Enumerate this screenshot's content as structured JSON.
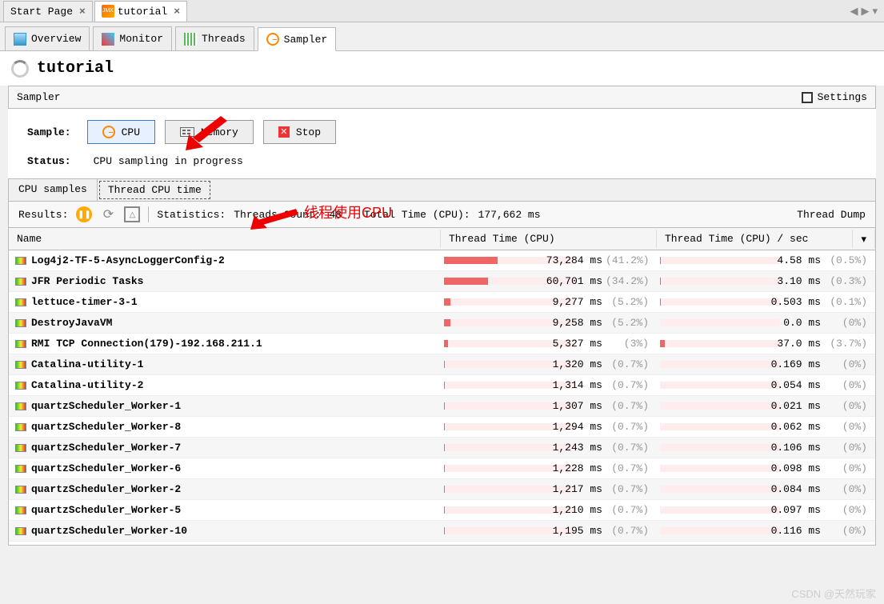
{
  "top_tabs": {
    "start_page": "Start Page",
    "tutorial": "tutorial"
  },
  "sub_tabs": {
    "overview": "Overview",
    "monitor": "Monitor",
    "threads": "Threads",
    "sampler": "Sampler"
  },
  "title": "tutorial",
  "section": {
    "label": "Sampler",
    "settings": "Settings"
  },
  "sample": {
    "label": "Sample:",
    "cpu": "CPU",
    "memory": "Memory",
    "stop": "Stop"
  },
  "status": {
    "label": "Status:",
    "value": "CPU sampling in progress"
  },
  "result_tabs": {
    "cpu_samples": "CPU samples",
    "thread_cpu_time": "Thread CPU time"
  },
  "toolbar": {
    "results": "Results:",
    "stat_prefix": "Statistics:",
    "thread_count_label": "Threads Count:",
    "thread_count": "48",
    "total_label": "Total Time (CPU):",
    "total_value": "177,662 ms",
    "thread_dump": "Thread Dump"
  },
  "columns": {
    "name": "Name",
    "time": "Thread Time (CPU)",
    "psec": "Thread Time (CPU) / sec"
  },
  "annotation": "线程使用CPU",
  "watermark": "CSDN @天然玩家",
  "rows": [
    {
      "name": "Log4j2-TF-5-AsyncLoggerConfig-2",
      "time": "73,284 ms",
      "time_pct": "(41.2%)",
      "time_bar": 41.2,
      "psec": "4.58 ms",
      "psec_pct": "(0.5%)",
      "psec_bar": 0.5
    },
    {
      "name": "JFR Periodic Tasks",
      "time": "60,701 ms",
      "time_pct": "(34.2%)",
      "time_bar": 34.2,
      "psec": "3.10 ms",
      "psec_pct": "(0.3%)",
      "psec_bar": 0.3
    },
    {
      "name": "lettuce-timer-3-1",
      "time": "9,277 ms",
      "time_pct": "(5.2%)",
      "time_bar": 5.2,
      "psec": "0.503 ms",
      "psec_pct": "(0.1%)",
      "psec_bar": 0.1
    },
    {
      "name": "DestroyJavaVM",
      "time": "9,258 ms",
      "time_pct": "(5.2%)",
      "time_bar": 5.2,
      "psec": "0.0 ms",
      "psec_pct": "(0%)",
      "psec_bar": 0
    },
    {
      "name": "RMI TCP Connection(179)-192.168.211.1",
      "time": "5,327 ms",
      "time_pct": "(3%)",
      "time_bar": 3,
      "psec": "37.0 ms",
      "psec_pct": "(3.7%)",
      "psec_bar": 3.7
    },
    {
      "name": "Catalina-utility-1",
      "time": "1,320 ms",
      "time_pct": "(0.7%)",
      "time_bar": 0.7,
      "psec": "0.169 ms",
      "psec_pct": "(0%)",
      "psec_bar": 0
    },
    {
      "name": "Catalina-utility-2",
      "time": "1,314 ms",
      "time_pct": "(0.7%)",
      "time_bar": 0.7,
      "psec": "0.054 ms",
      "psec_pct": "(0%)",
      "psec_bar": 0
    },
    {
      "name": "quartzScheduler_Worker-1",
      "time": "1,307 ms",
      "time_pct": "(0.7%)",
      "time_bar": 0.7,
      "psec": "0.021 ms",
      "psec_pct": "(0%)",
      "psec_bar": 0
    },
    {
      "name": "quartzScheduler_Worker-8",
      "time": "1,294 ms",
      "time_pct": "(0.7%)",
      "time_bar": 0.7,
      "psec": "0.062 ms",
      "psec_pct": "(0%)",
      "psec_bar": 0
    },
    {
      "name": "quartzScheduler_Worker-7",
      "time": "1,243 ms",
      "time_pct": "(0.7%)",
      "time_bar": 0.7,
      "psec": "0.106 ms",
      "psec_pct": "(0%)",
      "psec_bar": 0
    },
    {
      "name": "quartzScheduler_Worker-6",
      "time": "1,228 ms",
      "time_pct": "(0.7%)",
      "time_bar": 0.7,
      "psec": "0.098 ms",
      "psec_pct": "(0%)",
      "psec_bar": 0
    },
    {
      "name": "quartzScheduler_Worker-2",
      "time": "1,217 ms",
      "time_pct": "(0.7%)",
      "time_bar": 0.7,
      "psec": "0.084 ms",
      "psec_pct": "(0%)",
      "psec_bar": 0
    },
    {
      "name": "quartzScheduler_Worker-5",
      "time": "1,210 ms",
      "time_pct": "(0.7%)",
      "time_bar": 0.7,
      "psec": "0.097 ms",
      "psec_pct": "(0%)",
      "psec_bar": 0
    },
    {
      "name": "quartzScheduler_Worker-10",
      "time": "1,195 ms",
      "time_pct": "(0.7%)",
      "time_bar": 0.7,
      "psec": "0.116 ms",
      "psec_pct": "(0%)",
      "psec_bar": 0
    }
  ]
}
